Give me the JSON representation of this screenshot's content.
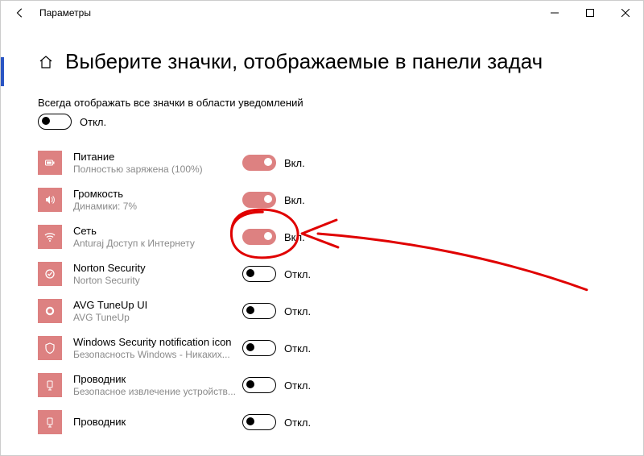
{
  "window": {
    "title": "Параметры"
  },
  "page": {
    "heading": "Выберите значки, отображаемые в панели задач",
    "subheading": "Всегда отображать все значки в области уведомлений"
  },
  "masterToggle": {
    "state": false,
    "label": "Откл."
  },
  "labels": {
    "on": "Вкл.",
    "off": "Откл."
  },
  "items": [
    {
      "icon": "power",
      "title": "Питание",
      "sub": "Полностью заряжена (100%)",
      "on": true
    },
    {
      "icon": "volume",
      "title": "Громкость",
      "sub": "Динамики: 7%",
      "on": true
    },
    {
      "icon": "network",
      "title": "Сеть",
      "sub": "Anturaj Доступ к Интернету",
      "on": true
    },
    {
      "icon": "norton",
      "title": "Norton Security",
      "sub": "Norton Security",
      "on": false
    },
    {
      "icon": "avg",
      "title": "AVG TuneUp UI",
      "sub": "AVG TuneUp",
      "on": false
    },
    {
      "icon": "shield",
      "title": "Windows Security notification icon",
      "sub": "Безопасность Windows - Никаких...",
      "on": false
    },
    {
      "icon": "explorer",
      "title": "Проводник",
      "sub": "Безопасное извлечение устройств...",
      "on": false
    },
    {
      "icon": "explorer",
      "title": "Проводник",
      "sub": "",
      "on": false
    }
  ]
}
